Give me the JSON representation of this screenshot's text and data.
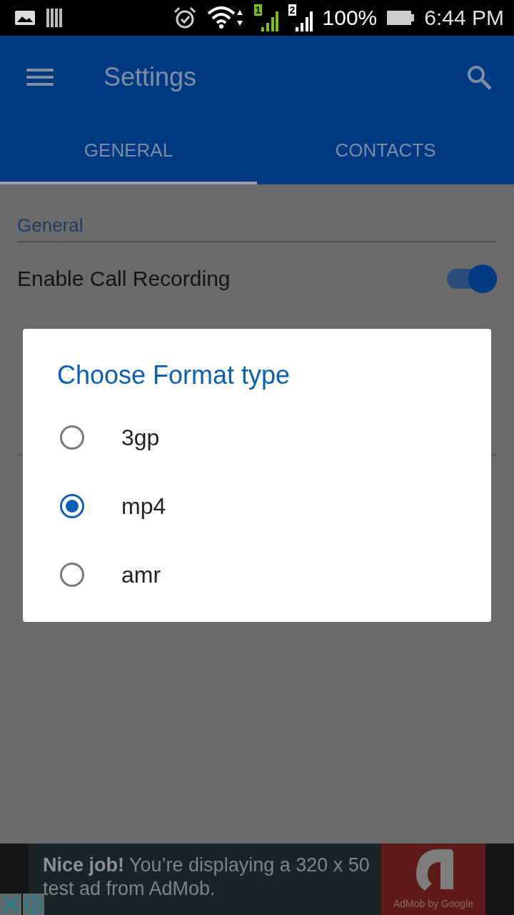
{
  "status_bar": {
    "sim_slots": [
      "1",
      "2"
    ],
    "battery": "100%",
    "time": "6:44 PM"
  },
  "app_bar": {
    "title": "Settings"
  },
  "tabs": [
    {
      "label": "GENERAL",
      "selected": true
    },
    {
      "label": "CONTACTS",
      "selected": false
    }
  ],
  "sections": [
    {
      "header": "General",
      "rows": [
        {
          "label": "Enable Call Recording",
          "kind": "toggle",
          "on": true
        }
      ]
    }
  ],
  "dialog": {
    "title": "Choose Format type",
    "options": [
      {
        "label": "3gp",
        "selected": false
      },
      {
        "label": "mp4",
        "selected": true
      },
      {
        "label": "amr",
        "selected": false
      }
    ]
  },
  "ad": {
    "text": "**Nice job!** You’re displaying a 320 x 50 test ad from AdMob.",
    "brand": "AdMob by Google"
  }
}
